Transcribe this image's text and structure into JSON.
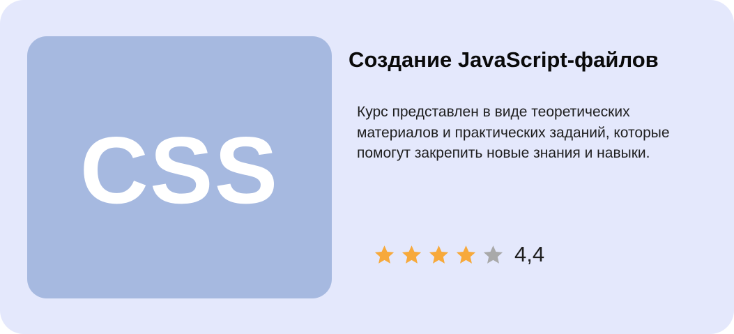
{
  "card": {
    "thumbnail_label": "CSS",
    "title": "Создание JavaScript-файлов",
    "description": "Курс представлен в виде теоретических материалов и практических заданий, которые помогут закрепить новые знания и навыки.",
    "rating": {
      "value": "4,4",
      "filled_stars": 4,
      "total_stars": 5
    }
  },
  "colors": {
    "card_background": "#e4e8fc",
    "thumbnail_background": "#a6b9e0",
    "star_filled": "#f7a93b",
    "star_empty": "#a9a9a9",
    "text_primary": "#0a0a0a"
  },
  "icons": {
    "star_filled": "star-filled-icon",
    "star_empty": "star-empty-icon"
  }
}
